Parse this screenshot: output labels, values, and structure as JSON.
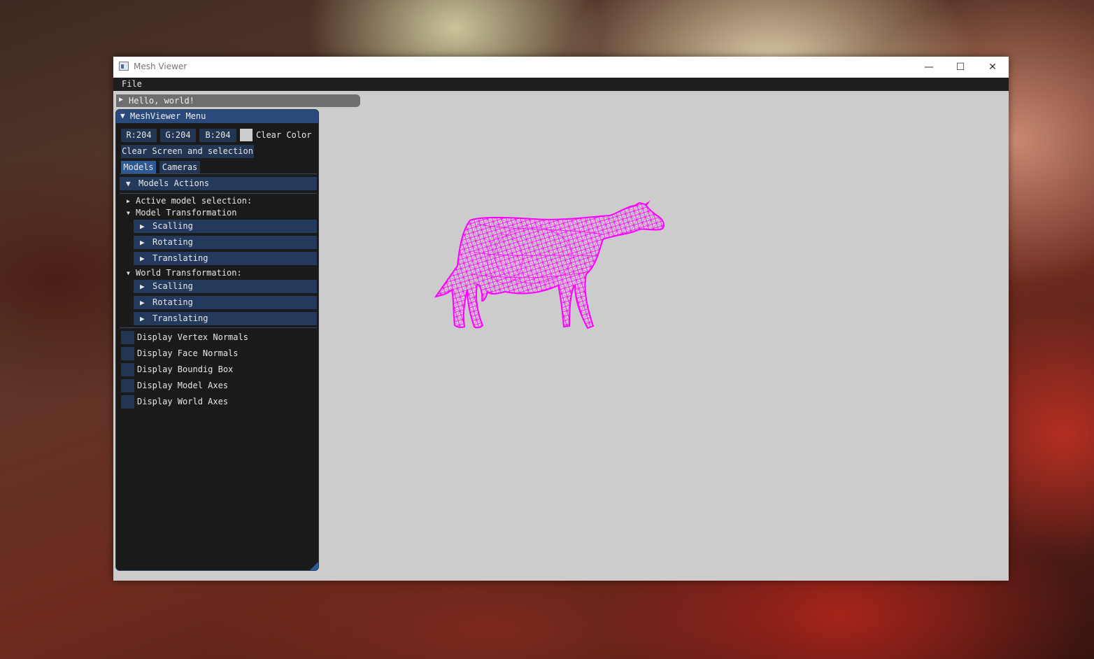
{
  "window": {
    "title": "Mesh Viewer",
    "controls": {
      "minimize": "—",
      "maximize": "☐",
      "close": "✕"
    }
  },
  "menubar": {
    "items": [
      "File"
    ]
  },
  "hello_window": {
    "title": "Hello, world!",
    "arrow": "▶"
  },
  "menu_panel": {
    "title": "MeshViewer Menu",
    "arrow": "▼",
    "clear_color": {
      "r": "R:204",
      "g": "G:204",
      "b": "B:204",
      "label": "Clear Color",
      "swatch_color": "#cccccc"
    },
    "clear_screen_button": "Clear Screen and selection",
    "tabs": {
      "models": "Models",
      "cameras": "Cameras"
    },
    "models_actions": {
      "arrow": "▼",
      "label": "Models Actions"
    },
    "active_model_selection": {
      "arrow": "▶",
      "label": "Active model selection:"
    },
    "model_transformation": {
      "arrow": "▼",
      "label": "Model Transformation",
      "scaling": "Scalling",
      "rotating": "Rotating",
      "translating": "Translating"
    },
    "world_transformation": {
      "arrow": "▼",
      "label": "World Transformation:",
      "scaling": "Scalling",
      "rotating": "Rotating",
      "translating": "Translating"
    },
    "sub_arrow": "▶",
    "checkboxes": {
      "vertex_normals": "Display Vertex Normals",
      "face_normals": "Display Face Normals",
      "bounding_box": "Display Boundig Box",
      "model_axes": "Display Model Axes",
      "world_axes": "Display World Axes"
    }
  },
  "viewport": {
    "background": "#cccccc",
    "mesh_color": "#ff00ff",
    "mesh_icon": "cow-wireframe"
  }
}
